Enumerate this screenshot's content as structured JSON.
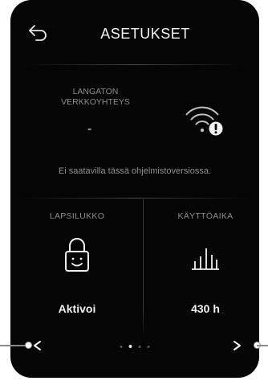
{
  "header": {
    "title": "ASETUKSET",
    "back_icon": "back-arrow-icon"
  },
  "wifi": {
    "label": "LANGATON VERKKOYHTEYS",
    "value": "-",
    "icon": "wifi-warning-icon",
    "note": "Ei saatavilla tässä ohjelmistoversiossa."
  },
  "child_lock": {
    "label": "LAPSILUKKO",
    "icon": "lock-icon",
    "value": "Aktivoi"
  },
  "usage_time": {
    "label": "KÄYTTÖAIKA",
    "icon": "bar-chart-icon",
    "value": "430 h"
  },
  "pager": {
    "prev_icon": "chevron-left-icon",
    "next_icon": "chevron-right-icon",
    "pages": 4,
    "active_page": 2
  },
  "colors": {
    "screen_bg": "#050505",
    "text": "#f0f0f0",
    "muted": "#8c8c8c"
  }
}
